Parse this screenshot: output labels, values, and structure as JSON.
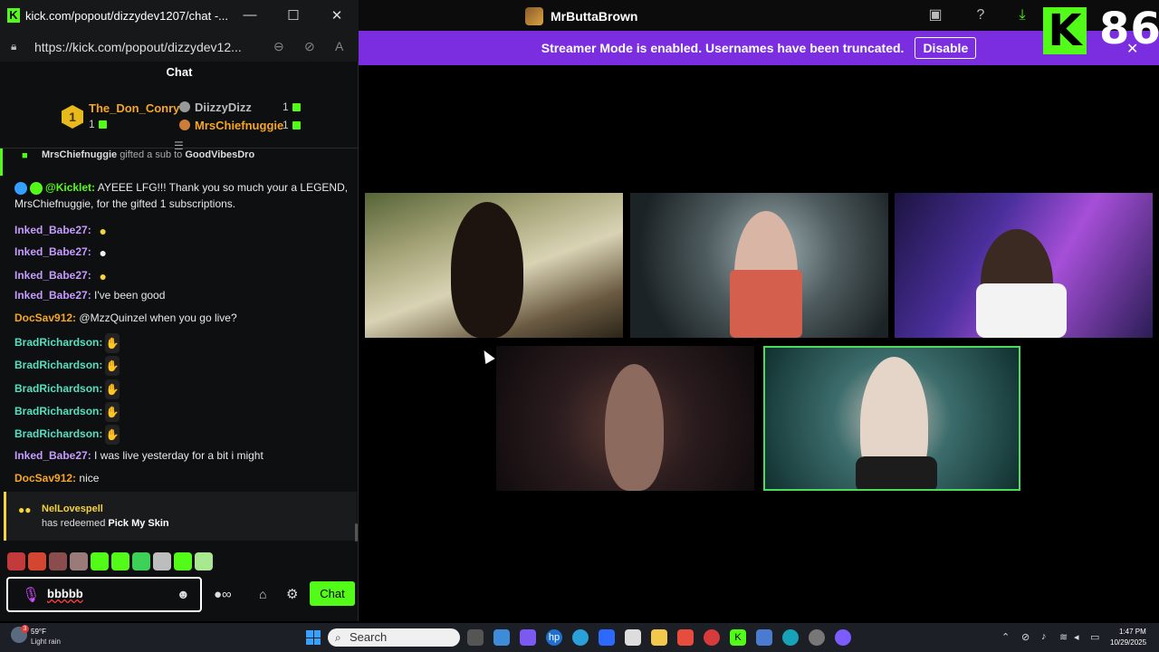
{
  "stream_window": {
    "title": "MrButtaBrown",
    "banner_text": "Streamer Mode is enabled. Usernames have been truncated.",
    "disable_label": "Disable",
    "kick_logo_letter": "K",
    "counter": "86"
  },
  "popout": {
    "window_title": "kick.com/popout/dizzydev1207/chat -...",
    "favicon": "K",
    "url": "https://kick.com/popout/dizzydev12...",
    "header": "Chat"
  },
  "leaderboard": {
    "first": {
      "rank": "1",
      "name": "The_Don_Conry",
      "count": "1"
    },
    "second": {
      "name": "DiizzyDizz",
      "count": "1"
    },
    "third": {
      "name": "MrsChiefnuggie",
      "count": "1"
    }
  },
  "sub_notice": {
    "gifter": "MrsChiefnuggie",
    "text": "gifted a sub to",
    "recipient": "GoodVibesDro"
  },
  "messages": [
    {
      "user": "@Kicklet:",
      "text": "AYEEE LFG!!! Thank you so much your a LEGEND, MrsChiefnuggie, for the gifted 1 subscriptions."
    },
    {
      "user": "Inked_Babe27:",
      "text": "",
      "emote": "duck"
    },
    {
      "user": "Inked_Babe27:",
      "text": "",
      "emote": "ghost"
    },
    {
      "user": "Inked_Babe27:",
      "text": "",
      "emote": "duck"
    },
    {
      "user": "Inked_Babe27:",
      "text": "I've been good"
    },
    {
      "user": "DocSav912:",
      "text": "@MzzQuinzel when you go live?"
    },
    {
      "user": "BradRichardson:",
      "text": "",
      "emote": "rock"
    },
    {
      "user": "BradRichardson:",
      "text": "",
      "emote": "rock"
    },
    {
      "user": "BradRichardson:",
      "text": "",
      "emote": "rock"
    },
    {
      "user": "BradRichardson:",
      "text": "",
      "emote": "rock"
    },
    {
      "user": "BradRichardson:",
      "text": "",
      "emote": "rock"
    },
    {
      "user": "Inked_Babe27:",
      "text": "I was live yesterday for a bit i might"
    },
    {
      "user": "DocSav912:",
      "text": "nice"
    }
  ],
  "redeem": {
    "user": "NelLovespell",
    "text_prefix": "has redeemed",
    "reward": "Pick My Skin"
  },
  "chat_input": {
    "value": "bbbbb",
    "send_label": "Chat"
  },
  "emote_bar": [
    "emote-1",
    "emote-2",
    "emote-3",
    "emote-4",
    "emote-5",
    "emote-6",
    "emote-7",
    "emote-8",
    "emote-9",
    "emote-10"
  ],
  "taskbar": {
    "weather_temp": "59°F",
    "weather_desc": "Light rain",
    "weather_badge": "3",
    "search_label": "Search",
    "time": "1:47 PM",
    "date": "10/29/2025"
  },
  "colors": {
    "kick_green": "#53fc18",
    "banner_purple": "#7b2ee0",
    "highlight_border": "#4ddc5a"
  }
}
